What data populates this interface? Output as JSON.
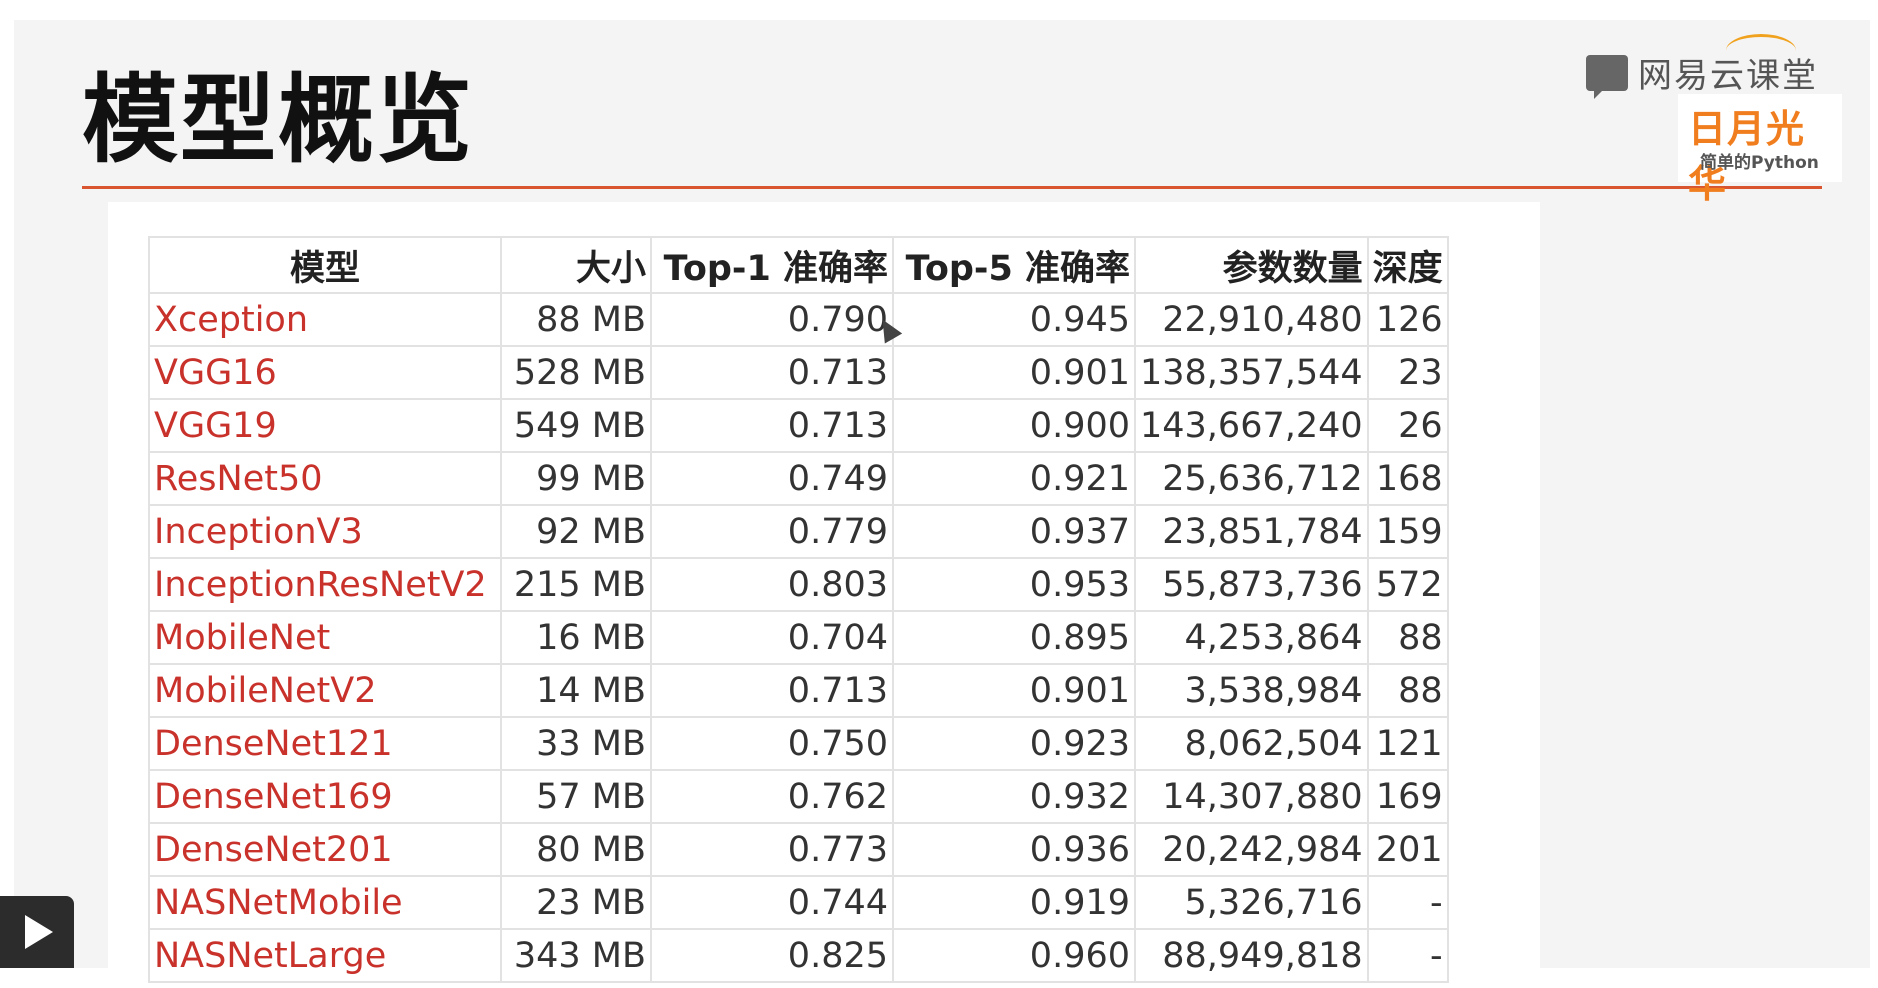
{
  "slide": {
    "title": "模型概览"
  },
  "logo": {
    "platform": "网易云课堂",
    "brand": "日月光华",
    "subtitle": "简单的Python"
  },
  "table": {
    "headers": [
      "模型",
      "大小",
      "Top-1 准确率",
      "Top-5 准确率",
      "参数数量",
      "深度"
    ],
    "rows": [
      [
        "Xception",
        "88 MB",
        "0.790",
        "0.945",
        "22,910,480",
        "126"
      ],
      [
        "VGG16",
        "528 MB",
        "0.713",
        "0.901",
        "138,357,544",
        "23"
      ],
      [
        "VGG19",
        "549 MB",
        "0.713",
        "0.900",
        "143,667,240",
        "26"
      ],
      [
        "ResNet50",
        "99 MB",
        "0.749",
        "0.921",
        "25,636,712",
        "168"
      ],
      [
        "InceptionV3",
        "92 MB",
        "0.779",
        "0.937",
        "23,851,784",
        "159"
      ],
      [
        "InceptionResNetV2",
        "215 MB",
        "0.803",
        "0.953",
        "55,873,736",
        "572"
      ],
      [
        "MobileNet",
        "16 MB",
        "0.704",
        "0.895",
        "4,253,864",
        "88"
      ],
      [
        "MobileNetV2",
        "14 MB",
        "0.713",
        "0.901",
        "3,538,984",
        "88"
      ],
      [
        "DenseNet121",
        "33 MB",
        "0.750",
        "0.923",
        "8,062,504",
        "121"
      ],
      [
        "DenseNet169",
        "57 MB",
        "0.762",
        "0.932",
        "14,307,880",
        "169"
      ],
      [
        "DenseNet201",
        "80 MB",
        "0.773",
        "0.936",
        "20,242,984",
        "201"
      ],
      [
        "NASNetMobile",
        "23 MB",
        "0.744",
        "0.919",
        "5,326,716",
        "-"
      ],
      [
        "NASNetLarge",
        "343 MB",
        "0.825",
        "0.960",
        "88,949,818",
        "-"
      ]
    ]
  },
  "colors": {
    "accent_rule": "#d8552f",
    "model_link": "#c9312b",
    "brand_orange": "#f07d1e"
  },
  "icons": {
    "play": "play-icon",
    "logo": "chat-bubble-icon",
    "cursor": "mouse-cursor-icon"
  }
}
